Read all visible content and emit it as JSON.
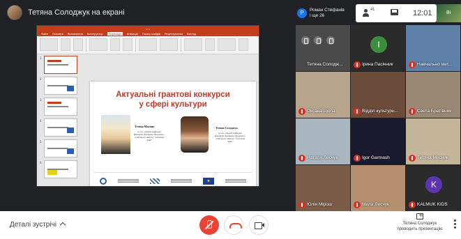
{
  "header": {
    "presenting_label": "Тетяна Солоджук на екрані",
    "participant_pill": {
      "initial": "Р",
      "line1": "Роман Стефанів",
      "line2": "і ще 26"
    },
    "participants_count": "41",
    "clock": "12:01",
    "corner_label": "Ві"
  },
  "slide": {
    "title_line1": "Актуальні грантові конкурси",
    "title_line2": "у сфері культури",
    "person1_name": "Тетяна Мисник",
    "person1_desc": "к.е.н., доцент кафедри фінансів, фахівець Проектно-освітнього центру \"Аспекти змін\"",
    "person2_name": "Тетяна Солоджук",
    "person2_desc": "к.е.н., доцент кафедри фінансів, фахівець Проектно-освітнього центру \"Аспекти змін\""
  },
  "ribbon_tabs": [
    "Файл",
    "Основне",
    "Вставлення",
    "Конструктор",
    "Переходи",
    "Анімація",
    "Показ слайдів",
    "Рецензування",
    "Вигляд"
  ],
  "tiles": [
    {
      "name": "Тетяна Солодж...",
      "avatar": "",
      "bg": "#4a4a4a",
      "muted": false
    },
    {
      "name": "Ірина Пасічник",
      "avatar": "І",
      "bg": "#2b2b2b",
      "av_color": "#3c8e3c",
      "muted": true
    },
    {
      "name": "Навчально мет...",
      "avatar": "",
      "bg": "#5d7fa8",
      "muted": true
    },
    {
      "name": "Оксана Цюпа",
      "avatar": "",
      "bg": "#b9a58e",
      "muted": true
    },
    {
      "name": "Відділ культури...",
      "avatar": "",
      "bg": "#6b4b3a",
      "muted": true
    },
    {
      "name": "Света Братівник",
      "avatar": "",
      "bg": "#9a8874",
      "muted": true
    },
    {
      "name": "Наталя Лесчук",
      "avatar": "",
      "bg": "#a9b6c0",
      "muted": true
    },
    {
      "name": "Igor Garmash",
      "avatar": "",
      "bg": "#1a1a2e",
      "muted": true
    },
    {
      "name": "Тетяна Мисник",
      "avatar": "",
      "bg": "#c5b69a",
      "muted": true
    },
    {
      "name": "Юлія Мірош",
      "avatar": "",
      "bg": "#7a5c48",
      "muted": true
    },
    {
      "name": "Мила Лесчук",
      "avatar": "",
      "bg": "#b58f6e",
      "muted": true
    },
    {
      "name": "KALMUK KIDS",
      "avatar": "K",
      "bg": "#2b2b2b",
      "av_color": "#5e35b1",
      "muted": true
    }
  ],
  "bottom": {
    "details_label": "Деталі зустрічі",
    "presenter_line1": "Тетяна Солоджук",
    "presenter_line2": "проводить презентацію"
  }
}
